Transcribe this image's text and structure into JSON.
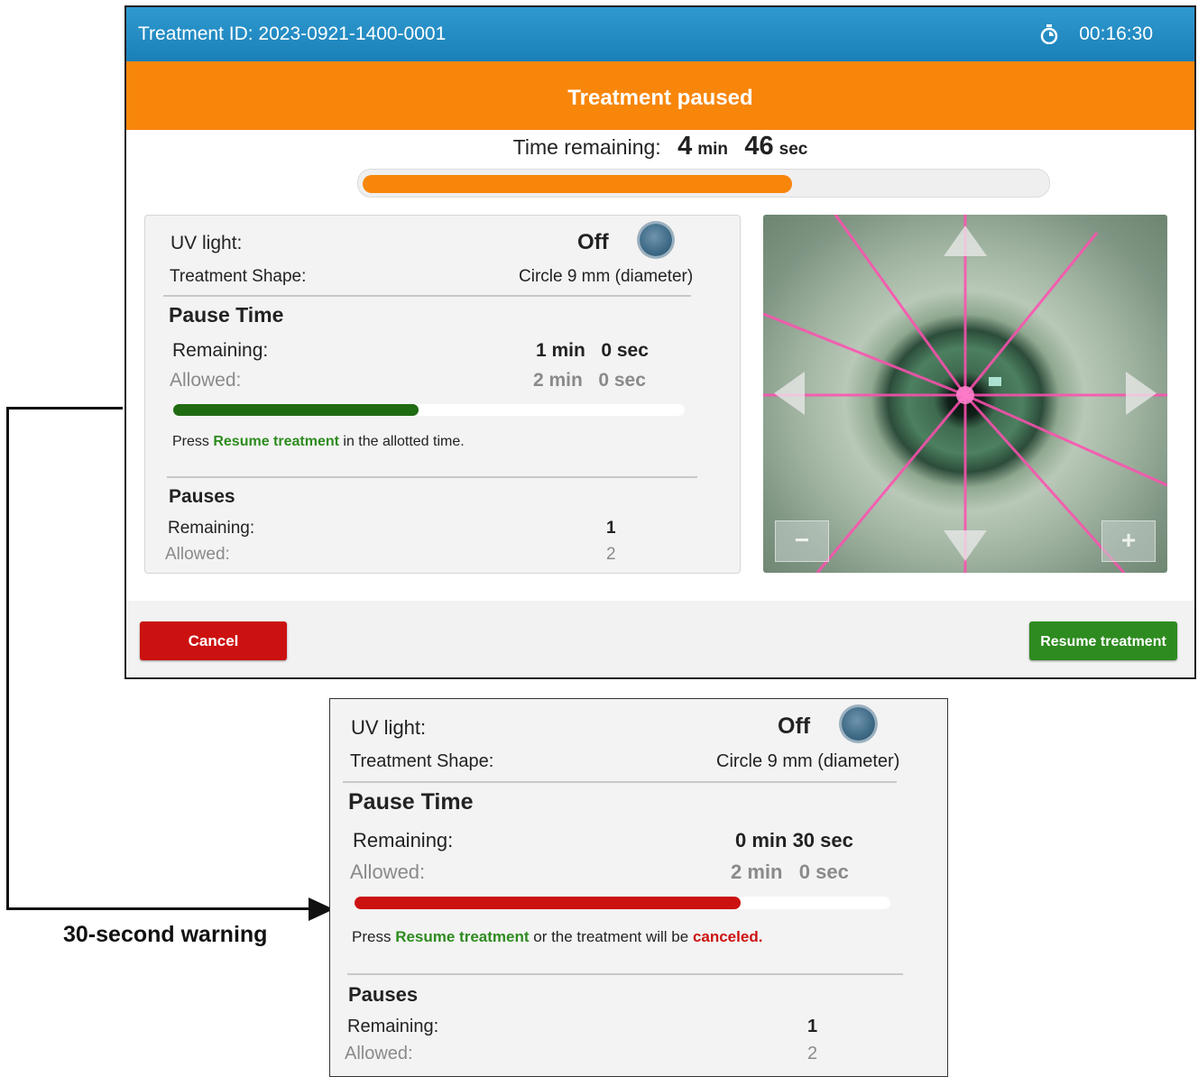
{
  "header": {
    "treatment_id": "Treatment ID: 2023-0921-1400-0001",
    "elapsed_time": "00:16:30",
    "stopwatch_icon": "stopwatch-icon"
  },
  "banner": {
    "status": "Treatment paused"
  },
  "time_remaining": {
    "label": "Time remaining:",
    "minutes": "4",
    "min_unit": "min",
    "seconds": "46",
    "sec_unit": "sec",
    "progress_fraction": 0.63
  },
  "panel_main": {
    "uv_label": "UV light:",
    "uv_value": "Off",
    "shape_label": "Treatment Shape:",
    "shape_value": "Circle 9 mm (diameter)",
    "pause_title": "Pause Time",
    "remaining_label": "Remaining:",
    "remaining_value": "1 min   0 sec",
    "allowed_label": "Allowed:",
    "allowed_value": "2 min   0 sec",
    "pause_progress_fraction": 0.48,
    "pause_bar_color": "#1f6b12",
    "msg_prefix": "Press ",
    "msg_action": "Resume treatment",
    "msg_suffix": " in the allotted time.",
    "pauses_title": "Pauses",
    "pauses_remaining_label": "Remaining:",
    "pauses_remaining_value": "1",
    "pauses_allowed_label": "Allowed:",
    "pauses_allowed_value": "2"
  },
  "camera": {
    "up_arrow": "triangle-up-icon",
    "down_arrow": "triangle-down-icon",
    "left_arrow": "triangle-left-icon",
    "right_arrow": "triangle-right-icon",
    "zoom_out_label": "−",
    "zoom_in_label": "+"
  },
  "buttons": {
    "cancel_label": "Cancel",
    "resume_label": "Resume treatment"
  },
  "callout": {
    "label": "30-second warning"
  },
  "panel_warning": {
    "uv_label": "UV light:",
    "uv_value": "Off",
    "shape_label": "Treatment Shape:",
    "shape_value": "Circle 9 mm (diameter)",
    "pause_title": "Pause Time",
    "remaining_label": "Remaining:",
    "remaining_value": "0 min 30 sec",
    "allowed_label": "Allowed:",
    "allowed_value": "2 min   0 sec",
    "pause_progress_fraction": 0.72,
    "pause_bar_color": "#cc1111",
    "msg_prefix": "Press ",
    "msg_action": "Resume treatment",
    "msg_middle": " or the treatment will be ",
    "msg_warning": "canceled.",
    "pauses_title": "Pauses",
    "pauses_remaining_label": "Remaining:",
    "pauses_remaining_value": "1",
    "pauses_allowed_label": "Allowed:",
    "pauses_allowed_value": "2"
  },
  "colors": {
    "header_blue": "#1a7fb8",
    "banner_orange": "#f8860b",
    "cancel_red": "#cc1111",
    "resume_green": "#2e8b1f"
  }
}
